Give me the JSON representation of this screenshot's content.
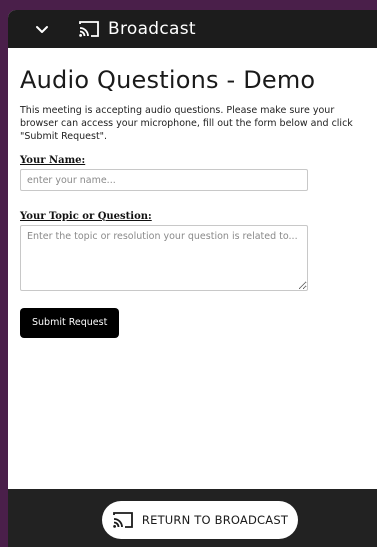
{
  "header": {
    "collapse_icon": "chevron-down-icon",
    "cast_icon": "cast-icon",
    "title": "Broadcast"
  },
  "main": {
    "title": "Audio Questions - Demo",
    "intro": "This meeting is accepting audio questions. Please make sure your browser can access your microphone, fill out the form below and click \"Submit Request\".",
    "name_label": "Your Name:",
    "name_placeholder": "enter your name...",
    "topic_label": "Your Topic or Question:",
    "topic_placeholder": "Enter the topic or resolution your question is related to...",
    "submit_label": "Submit Request"
  },
  "footer": {
    "return_icon": "cast-icon",
    "return_label": "RETURN TO BROADCAST"
  },
  "colors": {
    "frame": "#4a1f4a",
    "topbar": "#1c1c1c",
    "footer": "#222222",
    "button": "#000000"
  }
}
